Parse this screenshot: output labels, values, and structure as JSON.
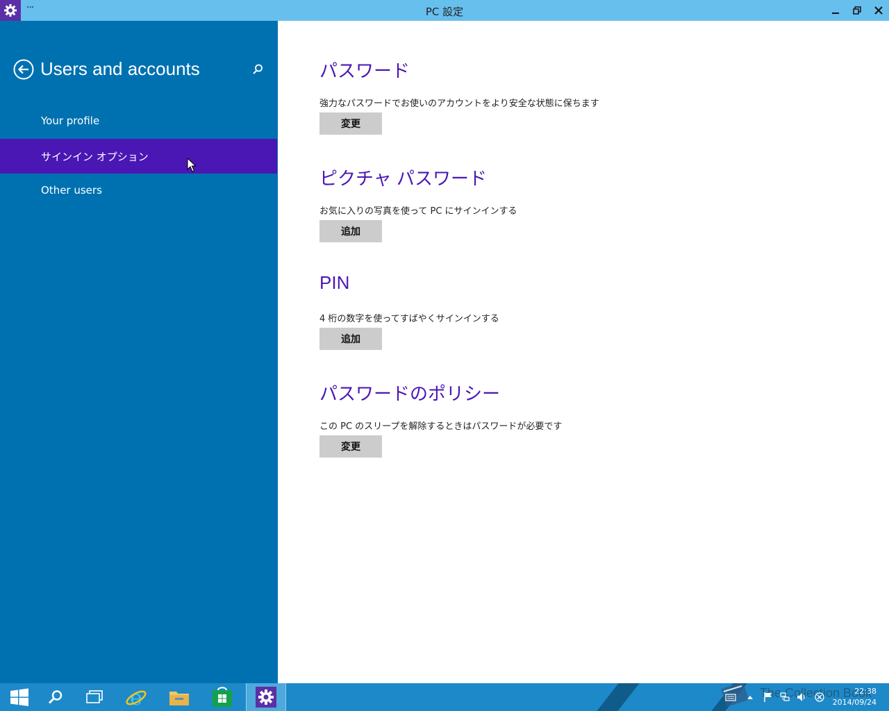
{
  "window": {
    "title": "PC 設定",
    "menu": "···"
  },
  "sidebar": {
    "title": "Users and accounts",
    "items": [
      {
        "label": "Your profile"
      },
      {
        "label": "サインイン オプション"
      },
      {
        "label": "Other users"
      }
    ],
    "selected_index": 1
  },
  "sections": [
    {
      "heading": "パスワード",
      "description": "強力なパスワードでお使いのアカウントをより安全な状態に保ちます",
      "button": "変更"
    },
    {
      "heading": "ピクチャ パスワード",
      "description": "お気に入りの写真を使って PC にサインインする",
      "button": "追加"
    },
    {
      "heading": "PIN",
      "description": "4 桁の数字を使ってすばやくサインインする",
      "button": "追加"
    },
    {
      "heading": "パスワードのポリシー",
      "description": "この PC のスリープを解除するときはパスワードが必要です",
      "button": "変更"
    }
  ],
  "taskbar": {
    "time": "22:38",
    "date": "2014/09/24",
    "watermark": "The Collection Book"
  },
  "colors": {
    "titlebar": "#67bfee",
    "sidebar": "#0071b0",
    "accent": "#4a17b5",
    "taskbar": "#1e89c8"
  }
}
